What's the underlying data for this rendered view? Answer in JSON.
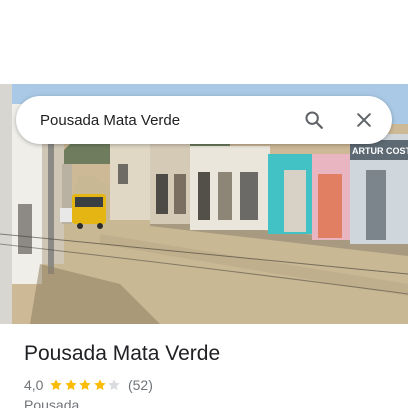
{
  "search": {
    "query": "Pousada Mata Verde",
    "search_icon": "search-icon",
    "close_icon": "close-icon"
  },
  "photo": {
    "shop_sign": "ARTUR COSTA"
  },
  "place": {
    "name": "Pousada Mata Verde",
    "rating_text": "4,0",
    "rating_value": 4.0,
    "max_rating": 5,
    "review_count_text": "(52)",
    "category": "Pousada"
  },
  "colors": {
    "star_filled": "#fbbc04",
    "star_empty": "#dadce0",
    "icon": "#5f6368",
    "title_text": "#202124",
    "secondary_text": "#70757a"
  }
}
